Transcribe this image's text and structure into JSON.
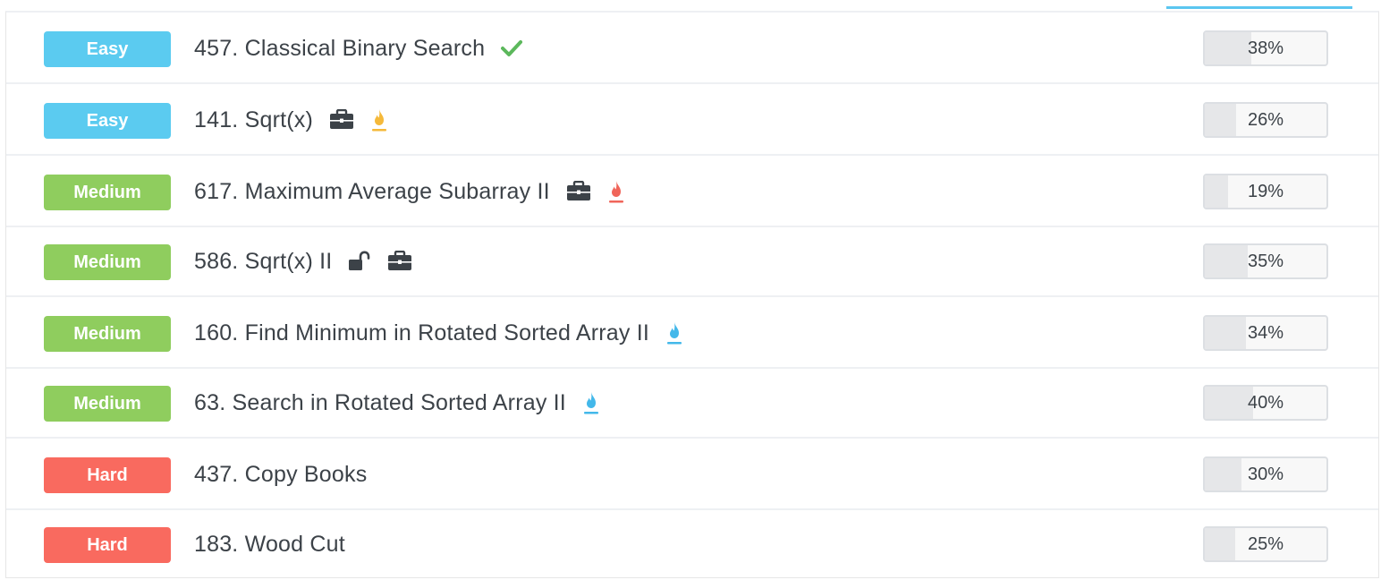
{
  "colors": {
    "Easy": "#5bcbf0",
    "Medium": "#8fcd5e",
    "Hard": "#f96a5f",
    "check": "#5cb85c",
    "fire_yellow": "#f5b93a",
    "fire_red": "#f0655a",
    "fire_blue": "#43b8ea",
    "icon_dark": "#3c4248"
  },
  "problems": [
    {
      "difficulty": "Easy",
      "title": "457. Classical Binary Search",
      "icons": [
        "check-icon"
      ],
      "rate_label": "38%",
      "rate": 0.38
    },
    {
      "difficulty": "Easy",
      "title": "141. Sqrt(x)",
      "icons": [
        "briefcase-icon",
        "fire-yellow-icon"
      ],
      "rate_label": "26%",
      "rate": 0.26
    },
    {
      "difficulty": "Medium",
      "title": "617. Maximum Average Subarray II",
      "icons": [
        "briefcase-icon",
        "fire-red-icon"
      ],
      "rate_label": "19%",
      "rate": 0.19
    },
    {
      "difficulty": "Medium",
      "title": "586. Sqrt(x) II",
      "icons": [
        "unlock-icon",
        "briefcase-icon"
      ],
      "rate_label": "35%",
      "rate": 0.35
    },
    {
      "difficulty": "Medium",
      "title": "160. Find Minimum in Rotated Sorted Array II",
      "icons": [
        "fire-blue-icon"
      ],
      "rate_label": "34%",
      "rate": 0.34
    },
    {
      "difficulty": "Medium",
      "title": "63. Search in Rotated Sorted Array II",
      "icons": [
        "fire-blue-icon"
      ],
      "rate_label": "40%",
      "rate": 0.4
    },
    {
      "difficulty": "Hard",
      "title": "437. Copy Books",
      "icons": [],
      "rate_label": "30%",
      "rate": 0.3
    },
    {
      "difficulty": "Hard",
      "title": "183. Wood Cut",
      "icons": [],
      "rate_label": "25%",
      "rate": 0.25
    }
  ]
}
